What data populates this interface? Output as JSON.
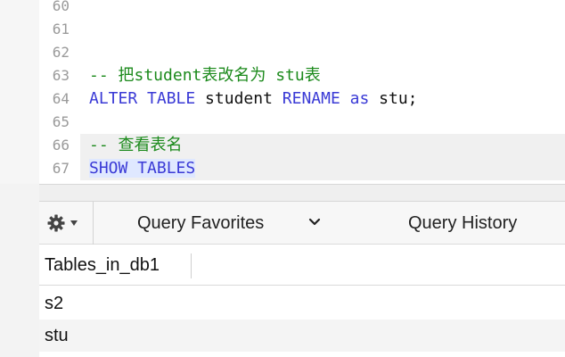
{
  "editor": {
    "lines": [
      {
        "num": "60",
        "segments": []
      },
      {
        "num": "61",
        "segments": []
      },
      {
        "num": "62",
        "segments": []
      },
      {
        "num": "63",
        "segments": [
          {
            "t": "-- 把student表改名为 stu表",
            "c": "comment"
          }
        ]
      },
      {
        "num": "64",
        "segments": [
          {
            "t": "ALTER TABLE",
            "c": "kw"
          },
          {
            "t": " student ",
            "c": "plain"
          },
          {
            "t": "RENAME as",
            "c": "kw"
          },
          {
            "t": " stu;",
            "c": "plain"
          }
        ]
      },
      {
        "num": "65",
        "segments": []
      },
      {
        "num": "66",
        "segments": [
          {
            "t": "-- 查看表名",
            "c": "comment"
          }
        ]
      },
      {
        "num": "67",
        "segments": [
          {
            "t": "SHOW TABLES",
            "c": "kw"
          }
        ]
      }
    ]
  },
  "toolbar": {
    "gear_icon": "gear-icon",
    "query_favorites": "Query Favorites",
    "query_history": "Query History"
  },
  "results": {
    "column": "Tables_in_db1",
    "rows": [
      "s2",
      "stu"
    ]
  }
}
